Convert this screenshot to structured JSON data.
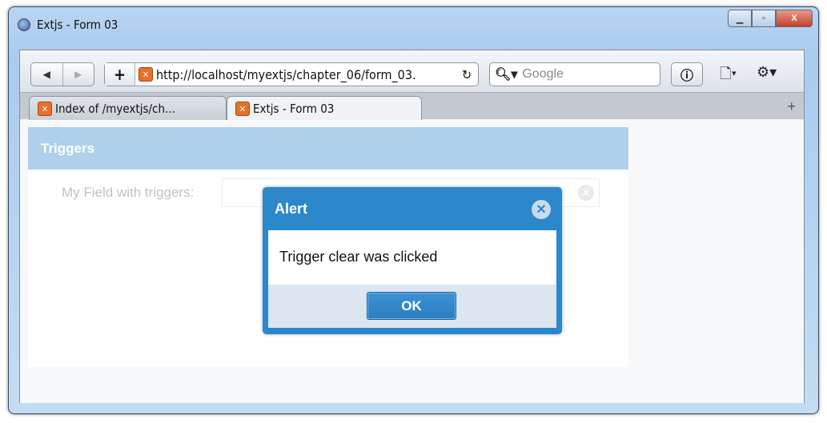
{
  "window": {
    "title": "Extjs - Form 03"
  },
  "toolbar": {
    "url": "http://localhost/myextjs/chapter_06/form_03.",
    "search_placeholder": "Google"
  },
  "tabs": [
    {
      "label": "Index of /myextjs/ch..."
    },
    {
      "label": "Extjs - Form 03",
      "active": true
    }
  ],
  "panel": {
    "title": "Triggers",
    "field_label": "My Field with triggers:",
    "field_value": ""
  },
  "dialog": {
    "title": "Alert",
    "message": "Trigger clear was clicked",
    "ok_label": "OK"
  },
  "colors": {
    "panel_header": "#aed0ea",
    "dialog": "#2c87cb"
  }
}
